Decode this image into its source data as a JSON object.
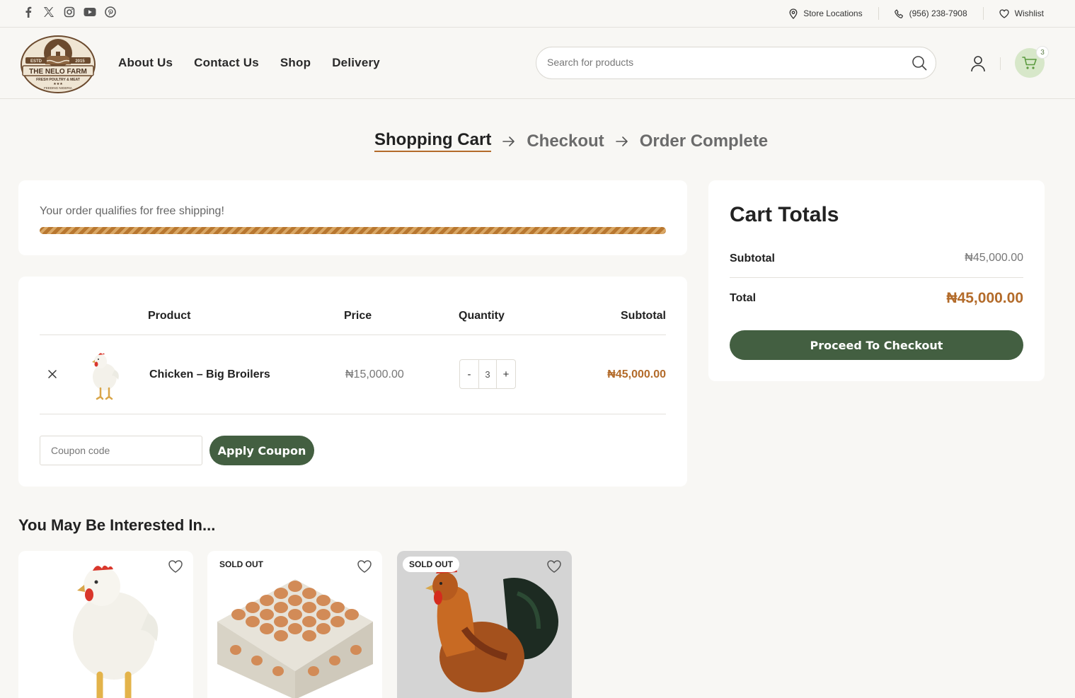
{
  "topbar": {
    "social": [
      "facebook-icon",
      "x-icon",
      "instagram-icon",
      "youtube-icon",
      "pinterest-icon"
    ],
    "store_locations": "Store Locations",
    "phone": "(956) 238-7908",
    "wishlist": "Wishlist"
  },
  "header": {
    "logo": {
      "estd": "ESTD",
      "year": "2015",
      "name": "THE NELO FARM",
      "tagline": "FRESH POULTRY & MEAT",
      "motto": "FEEDING NIGERIA"
    },
    "nav": [
      "About Us",
      "Contact Us",
      "Shop",
      "Delivery"
    ],
    "search_placeholder": "Search for products",
    "cart_count": "3"
  },
  "steps": {
    "cart": "Shopping Cart",
    "checkout": "Checkout",
    "complete": "Order Complete"
  },
  "shipping": {
    "message": "Your order qualifies for free shipping!",
    "progress": 1.0
  },
  "cart": {
    "headers": {
      "product": "Product",
      "price": "Price",
      "quantity": "Quantity",
      "subtotal": "Subtotal"
    },
    "item": {
      "name": "Chicken – Big Broilers",
      "price": "₦15,000.00",
      "quantity": "3",
      "subtotal": "₦45,000.00",
      "minus": "-",
      "plus": "+"
    },
    "coupon_placeholder": "Coupon code",
    "apply_label": "Apply Coupon"
  },
  "totals": {
    "title": "Cart Totals",
    "subtotal_label": "Subtotal",
    "subtotal_value": "₦45,000.00",
    "total_label": "Total",
    "total_value": "₦45,000.00",
    "checkout_label": "Proceed To Checkout"
  },
  "related": {
    "title": "You May Be Interested In...",
    "products": [
      {
        "badge": ""
      },
      {
        "badge": "SOLD OUT"
      },
      {
        "badge": "SOLD OUT"
      }
    ]
  },
  "colors": {
    "brand_green": "#435f41",
    "accent_brown": "#b36b2a",
    "background": "#f8f7f4"
  }
}
